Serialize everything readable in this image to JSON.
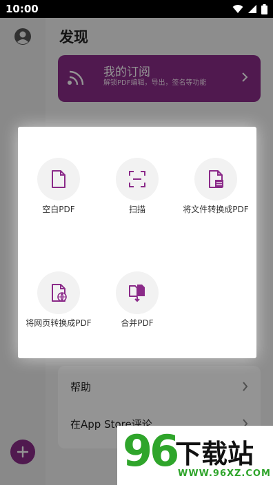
{
  "status_bar": {
    "time": "10:00"
  },
  "header": {
    "title": "发现"
  },
  "subscription": {
    "title": "我的订阅",
    "description": "解锁PDF编辑，导出，签名等功能"
  },
  "list": {
    "items": [
      {
        "label": "帮助"
      },
      {
        "label": "在App Store评论"
      }
    ]
  },
  "dialog": {
    "actions": [
      {
        "label": "空白PDF",
        "icon": "blank-document-icon"
      },
      {
        "label": "扫描",
        "icon": "scan-icon"
      },
      {
        "label": "将文件转换成PDF",
        "icon": "file-convert-icon"
      },
      {
        "label": "将网页转换成PDF",
        "icon": "web-convert-icon"
      },
      {
        "label": "合并PDF",
        "icon": "merge-icon"
      }
    ]
  },
  "watermark": {
    "number": "96",
    "text": "下载站",
    "url": "WWW.96XZ.COM"
  },
  "colors": {
    "accent": "#8b2b89",
    "watermark_green": "#2fa52b"
  }
}
